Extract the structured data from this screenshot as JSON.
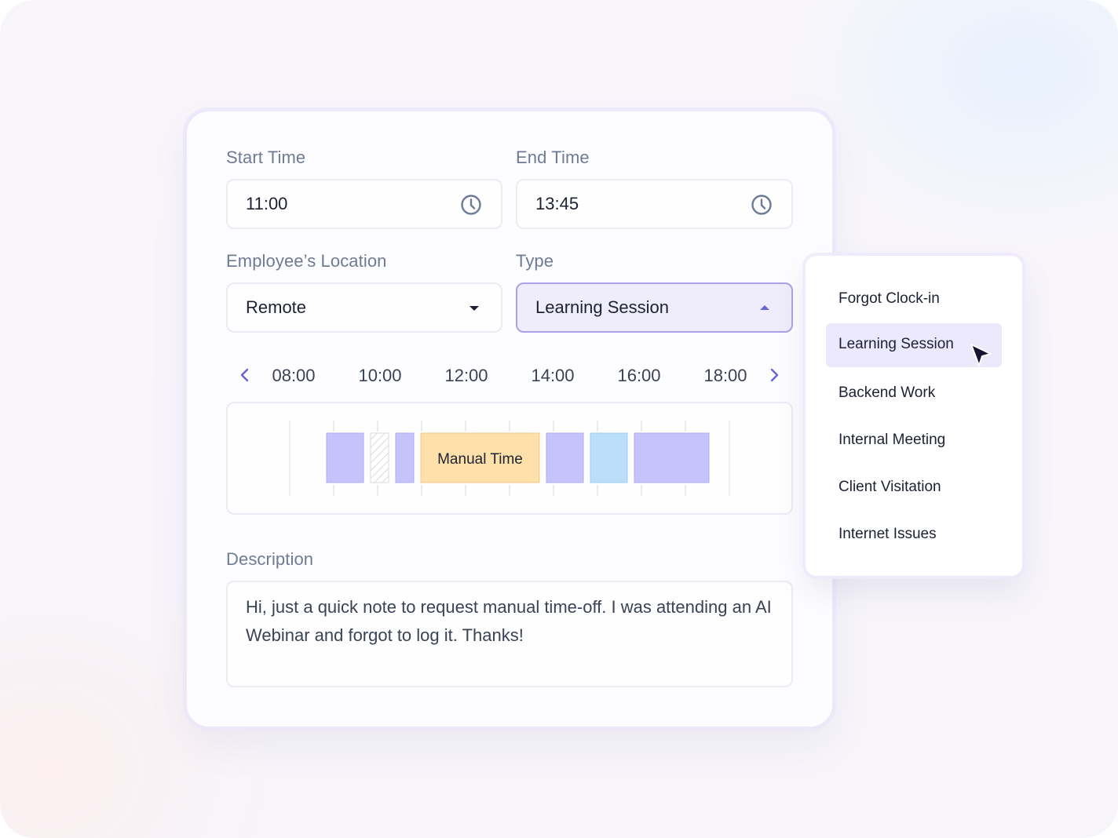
{
  "form": {
    "start_time": {
      "label": "Start Time",
      "value": "11:00",
      "icon": "clock-icon"
    },
    "end_time": {
      "label": "End Time",
      "value": "13:45",
      "icon": "clock-icon"
    },
    "location": {
      "label": "Employee’s Location",
      "value": "Remote",
      "icon": "caret-down-icon"
    },
    "type": {
      "label": "Type",
      "value": "Learning Session",
      "icon": "caret-up-icon",
      "expanded": true
    }
  },
  "timeline": {
    "hours": [
      "08:00",
      "10:00",
      "12:00",
      "14:00",
      "16:00",
      "18:00"
    ],
    "manual_label": "Manual Time",
    "colors": {
      "work": "#c5c3fb",
      "work_border": "#b0acf2",
      "manual": "#fde0aa",
      "manual_border": "#f3c987",
      "meeting": "#bcdff9",
      "meeting_border": "#9ccdf1",
      "hatched": "#d9d9df"
    }
  },
  "description": {
    "label": "Description",
    "text": "Hi, just a quick note to request manual time-off. I was attending an AI Webinar and forgot to log it. Thanks!"
  },
  "type_options": [
    {
      "label": "Forgot Clock-in",
      "selected": false
    },
    {
      "label": "Learning Session",
      "selected": true
    },
    {
      "label": "Backend Work",
      "selected": false
    },
    {
      "label": "Internal Meeting",
      "selected": false
    },
    {
      "label": "Client Visitation",
      "selected": false
    },
    {
      "label": "Internet Issues",
      "selected": false
    }
  ],
  "accent_color": "#6a63d8"
}
